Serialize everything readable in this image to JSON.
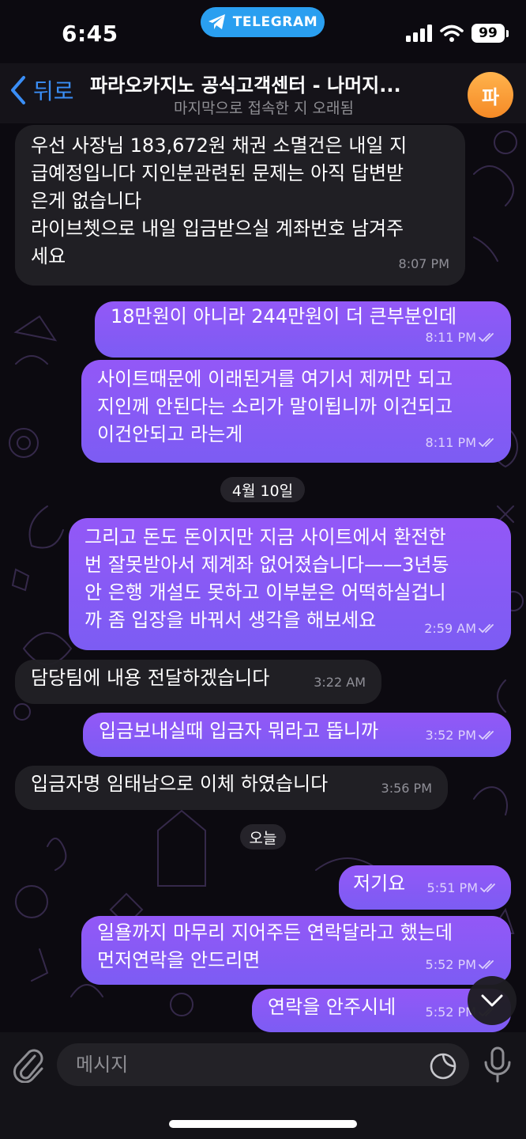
{
  "status_bar": {
    "time": "6:45",
    "app_pill": "TELEGRAM",
    "battery": "99"
  },
  "header": {
    "back_label": "뒤로",
    "title": "파라오카지노 공식고객센터 - 나머지...",
    "subtitle": "마지막으로 접속한 지 오래됨",
    "avatar_letter": "파"
  },
  "messages": [
    {
      "dir": "in",
      "lines": [
        "우선 사장님 183,672원 채권 소멸건은 내일 지",
        "급예정입니다 지인분관련된 문제는 아직 답변받",
        "은게 없습니다",
        "라이브쳇으로 내일 입금받으실 계좌번호 남겨주",
        "세요"
      ],
      "time": "8:07 PM"
    },
    {
      "dir": "out",
      "lines": [
        "18만원이 아니라 244만원이 더 큰부분인데"
      ],
      "time": "8:11 PM",
      "read": true
    },
    {
      "dir": "out",
      "lines": [
        "사이트때문에 이래된거를 여기서 제꺼만 되고",
        "지인께 안된다는 소리가 말이됩니까 이건되고",
        "이건안되고 라는게"
      ],
      "time": "8:11 PM",
      "read": true
    },
    {
      "dir": "out",
      "lines": [
        "그리고 돈도 돈이지만 지금 사이트에서 환전한",
        "번 잘못받아서 제계좌 없어졌습니다——3년동",
        "안 은행 개설도 못하고 이부분은 어떡하실겁니",
        "까 좀 입장을 바꿔서 생각을 해보세요"
      ],
      "time": "2:59 AM",
      "read": true
    },
    {
      "dir": "in",
      "lines": [
        "담당팀에 내용 전달하겠습니다"
      ],
      "time": "3:22 AM"
    },
    {
      "dir": "out",
      "lines": [
        "입금보내실때 입금자 뭐라고 뜹니까"
      ],
      "time": "3:52 PM",
      "read": true
    },
    {
      "dir": "in",
      "lines": [
        "입금자명 임태남으로 이체 하였습니다"
      ],
      "time": "3:56 PM"
    },
    {
      "dir": "out",
      "lines": [
        "저기요"
      ],
      "time": "5:51 PM",
      "read": true
    },
    {
      "dir": "out",
      "lines": [
        "일욜까지 마무리 지어주든 연락달라고 했는데",
        "먼저연락을 안드리면"
      ],
      "time": "5:52 PM",
      "read": true
    },
    {
      "dir": "out",
      "lines": [
        "연락을 안주시네"
      ],
      "time": "5:52 PM",
      "read": true
    }
  ],
  "date_separators": [
    "4월 10일",
    "오늘"
  ],
  "composer": {
    "placeholder": "메시지"
  },
  "colors": {
    "outgoing_bubble": "#8a5bf6",
    "incoming_bubble": "#212025",
    "accent_blue": "#3a8ef6",
    "telegram_pill": "#2a9ff0",
    "avatar": "#f79b33"
  },
  "icons": [
    "telegram-icon",
    "signal-icon",
    "wifi-icon",
    "battery-icon",
    "back-chevron-icon",
    "read-checks-icon",
    "chevron-down-icon",
    "paperclip-icon",
    "sticker-icon",
    "microphone-icon"
  ]
}
